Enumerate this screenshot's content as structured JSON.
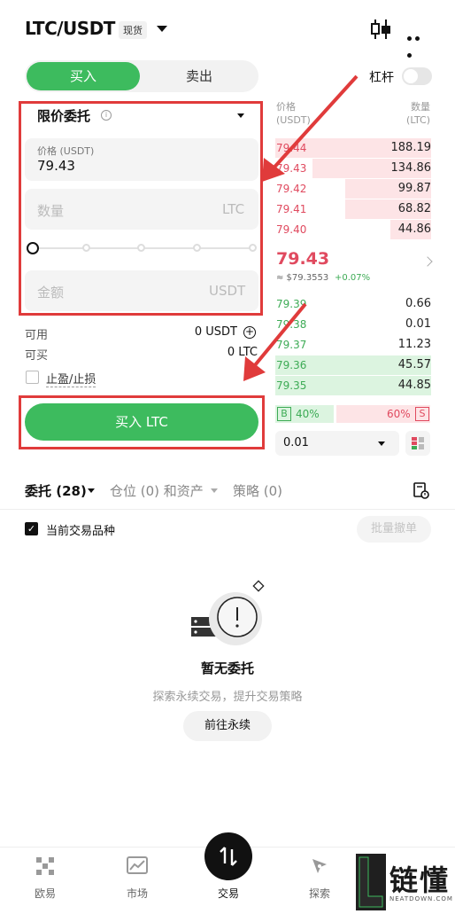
{
  "header": {
    "pair": "LTC/USDT",
    "market_badge": "现货",
    "icons": [
      "candlestick-icon",
      "more-icon"
    ]
  },
  "side_toggle": {
    "buy_label": "买入",
    "sell_label": "卖出",
    "selected": "buy"
  },
  "leverage": {
    "label": "杠杆",
    "enabled": false
  },
  "order_form": {
    "order_type": "限价委托",
    "price_label": "价格 (USDT)",
    "price_value": "79.43",
    "quantity_placeholder": "数量",
    "quantity_unit": "LTC",
    "amount_placeholder": "金额",
    "amount_unit": "USDT",
    "slider_percent": 0,
    "available_label": "可用",
    "available_value": "0 USDT",
    "can_buy_label": "可买",
    "can_buy_value": "0 LTC",
    "tpsl_label": "止盈/止损",
    "tpsl_checked": false,
    "submit_label": "买入 LTC"
  },
  "order_book": {
    "price_header": "价格",
    "price_unit": "(USDT)",
    "qty_header": "数量",
    "qty_unit": "(LTC)",
    "asks": [
      {
        "price": "79.44",
        "qty": "188.19",
        "depth": 1.0
      },
      {
        "price": "79.43",
        "qty": "134.86",
        "depth": 0.76
      },
      {
        "price": "79.42",
        "qty": "99.87",
        "depth": 0.55
      },
      {
        "price": "79.41",
        "qty": "68.82",
        "depth": 0.55
      },
      {
        "price": "79.40",
        "qty": "44.86",
        "depth": 0.26
      }
    ],
    "last_price": "79.43",
    "ref_price": "≈ $79.3553",
    "change": "+0.07%",
    "bids": [
      {
        "price": "79.39",
        "qty": "0.66",
        "depth": 0.0
      },
      {
        "price": "79.38",
        "qty": "0.01",
        "depth": 0.0
      },
      {
        "price": "79.37",
        "qty": "11.23",
        "depth": 0.0
      },
      {
        "price": "79.36",
        "qty": "45.57",
        "depth": 1.0
      },
      {
        "price": "79.35",
        "qty": "44.85",
        "depth": 1.0
      }
    ],
    "buy_badge": "B",
    "buy_ratio": "40%",
    "sell_ratio": "60%",
    "sell_badge": "S",
    "precision": "0.01"
  },
  "orders": {
    "tabs": [
      {
        "label": "委托 (28)",
        "active": true
      },
      {
        "label": "仓位 (0) 和资产",
        "active": false
      },
      {
        "label": "策略 (0)",
        "active": false
      }
    ],
    "current_pair_label": "当前交易品种",
    "current_pair_checked": true,
    "cancel_all_label": "批量撤单",
    "empty_title": "暂无委托",
    "empty_subtitle": "探索永续交易，提升交易策略",
    "go_button": "前往永续"
  },
  "bottom_nav": {
    "items": [
      {
        "label": "欧易",
        "icon": "logo-icon"
      },
      {
        "label": "市场",
        "icon": "chart-icon"
      },
      {
        "label": "交易",
        "icon": "trade-icon"
      },
      {
        "label": "探索",
        "icon": "compass-icon"
      }
    ]
  },
  "watermark": {
    "text": "链懂",
    "sub": "NEATDOWN.COM"
  },
  "colors": {
    "green": "#3dbb5e",
    "red": "#e04a5f",
    "annotation": "#e03b3b"
  }
}
